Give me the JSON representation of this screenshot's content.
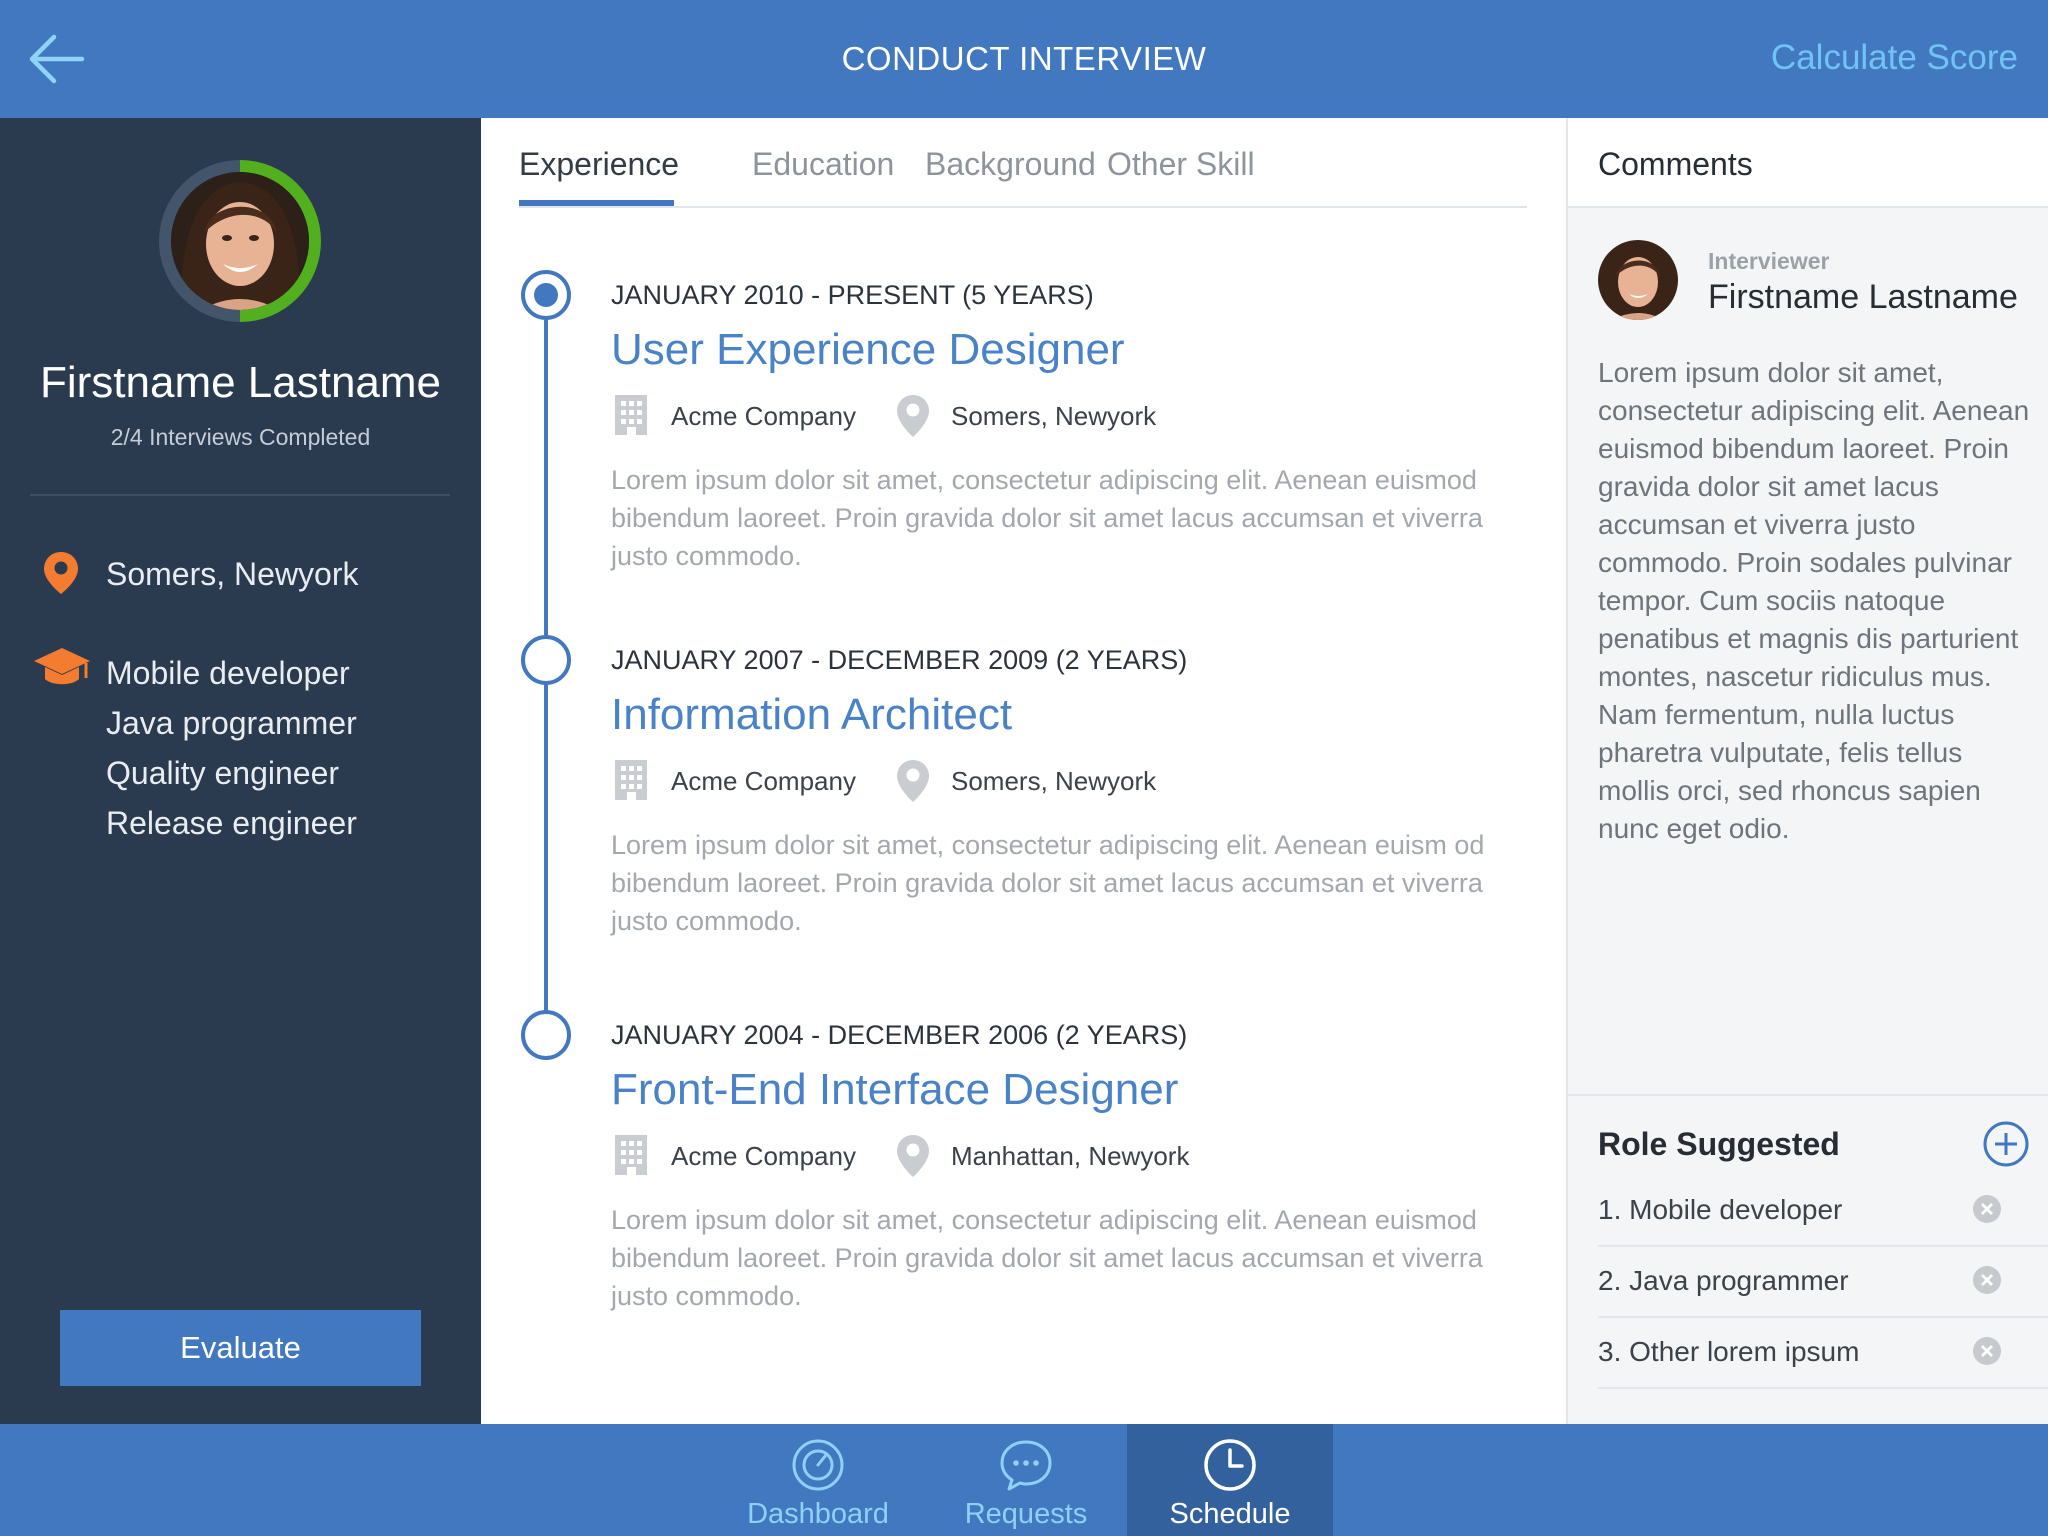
{
  "header": {
    "title": "CONDUCT INTERVIEW",
    "action": "Calculate Score"
  },
  "profile": {
    "name": "Firstname Lastname",
    "status": "2/4 Interviews Completed",
    "location": "Somers, Newyork",
    "roles": [
      "Mobile developer",
      "Java programmer",
      "Quality engineer",
      "Release engineer"
    ],
    "evaluate_label": "Evaluate",
    "progress": 0.5
  },
  "tabs": [
    {
      "label": "Experience",
      "active": true
    },
    {
      "label": "Education",
      "active": false
    },
    {
      "label": "Background",
      "active": false
    },
    {
      "label": "Other Skill",
      "active": false
    }
  ],
  "experience": [
    {
      "date": "JANUARY 2010 - PRESENT (5 YEARS)",
      "title": "User Experience Designer",
      "company": "Acme Company",
      "location": "Somers, Newyork",
      "description": "Lorem ipsum dolor sit amet, consectetur adipiscing elit. Aenean euismod bibendum laoreet. Proin gravida dolor sit amet lacus accumsan et viverra justo commodo."
    },
    {
      "date": "JANUARY 2007 - DECEMBER 2009 (2 YEARS)",
      "title": "Information Architect",
      "company": "Acme Company",
      "location": "Somers, Newyork",
      "description": "Lorem ipsum dolor sit amet, consectetur adipiscing elit. Aenean euism od bibendum laoreet. Proin gravida dolor sit amet lacus accumsan et viverra justo commodo."
    },
    {
      "date": "JANUARY 2004 - DECEMBER 2006 (2 YEARS)",
      "title": "Front-End Interface Designer",
      "company": "Acme Company",
      "location": "Manhattan, Newyork",
      "description": "Lorem ipsum dolor sit amet, consectetur adipiscing elit. Aenean euismod bibendum laoreet. Proin gravida dolor sit amet lacus accumsan et viverra justo commodo."
    }
  ],
  "comments": {
    "title": "Comments",
    "interviewer_label": "Interviewer",
    "interviewer_name": "Firstname Lastname",
    "text": "Lorem ipsum dolor sit amet, consectetur adipiscing elit. Aenean euismod bibendum laoreet. Proin gravida dolor sit amet lacus accumsan et viverra justo commodo. Proin sodales pulvinar tempor. Cum sociis natoque penatibus et magnis dis parturient montes, nascetur ridiculus mus. Nam fermentum, nulla luctus pharetra vulputate, felis tellus mollis orci, sed rhoncus sapien nunc eget odio."
  },
  "role_suggested": {
    "title": "Role Suggested",
    "items": [
      "1. Mobile developer",
      "2. Java programmer",
      "3. Other lorem ipsum"
    ]
  },
  "nav": [
    {
      "label": "Dashboard",
      "icon": "dashboard-icon",
      "active": false
    },
    {
      "label": "Requests",
      "icon": "chat-icon",
      "active": false
    },
    {
      "label": "Schedule",
      "icon": "clock-icon",
      "active": true
    }
  ],
  "colors": {
    "primary": "#4278bf",
    "sidebar": "#2a3a4f",
    "accent_orange": "#f47c30",
    "progress_green": "#52b01f",
    "link_light_blue": "#6fc3f5"
  }
}
